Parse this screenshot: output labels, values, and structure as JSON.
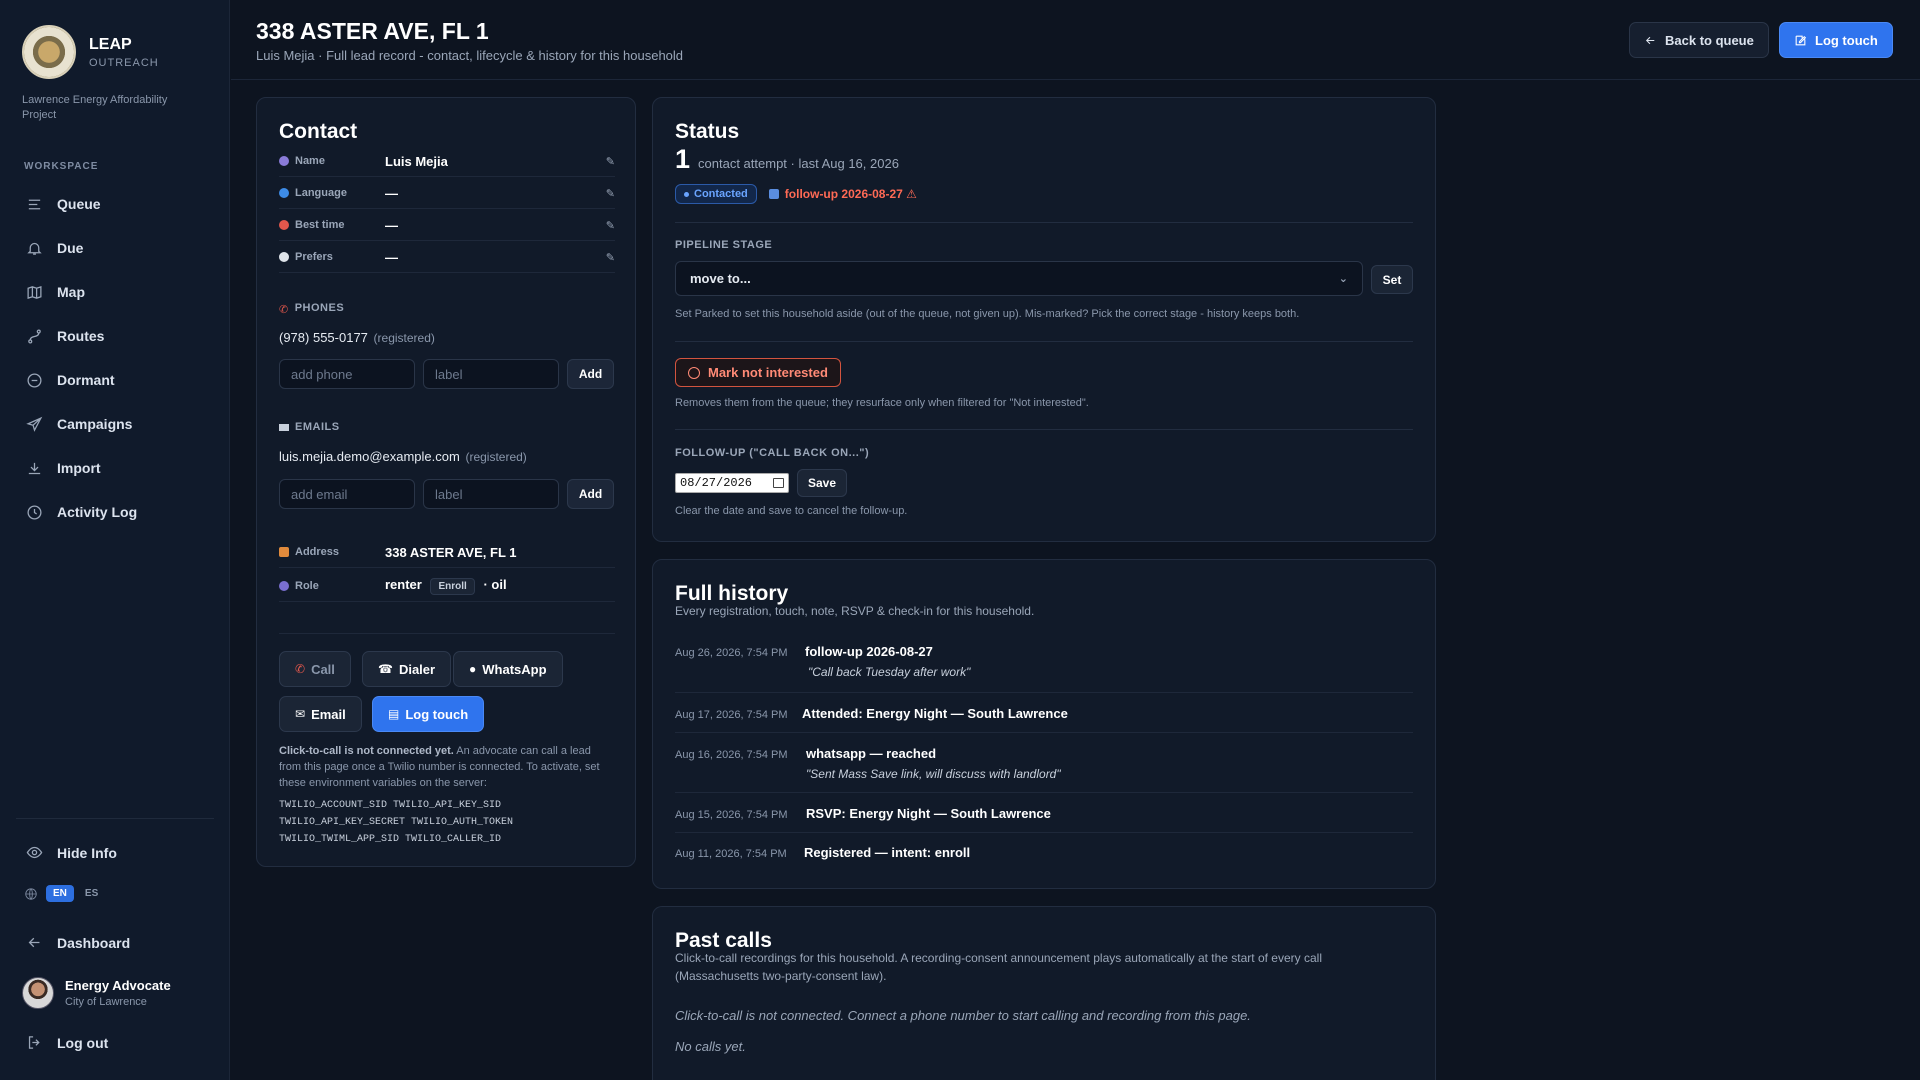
{
  "brand": {
    "name": "LEAP",
    "sub": "OUTREACH",
    "org": "Lawrence Energy Affordability Project"
  },
  "sidebar": {
    "workspace_label": "WORKSPACE",
    "items": [
      {
        "label": "Queue",
        "icon": "list-icon"
      },
      {
        "label": "Due",
        "icon": "bell-icon"
      },
      {
        "label": "Map",
        "icon": "map-icon"
      },
      {
        "label": "Routes",
        "icon": "route-icon"
      },
      {
        "label": "Dormant",
        "icon": "minus-circle-icon"
      },
      {
        "label": "Campaigns",
        "icon": "send-icon"
      },
      {
        "label": "Import",
        "icon": "download-icon"
      },
      {
        "label": "Activity Log",
        "icon": "clock-icon"
      }
    ],
    "hide_info": "Hide Info",
    "lang": {
      "en": "EN",
      "es": "ES",
      "active": "EN"
    },
    "dashboard": "Dashboard",
    "user": {
      "name": "Energy Advocate",
      "org": "City of Lawrence"
    },
    "logout": "Log out"
  },
  "header": {
    "title": "338 ASTER AVE, FL 1",
    "subtitle": "Luis Mejia · Full lead record - contact, lifecycle & history for this household",
    "back_label": "Back to queue",
    "log_label": "Log touch"
  },
  "contact": {
    "title": "Contact",
    "fields": [
      {
        "label": "Name",
        "value": "Luis Mejia"
      },
      {
        "label": "Language",
        "value": "—"
      },
      {
        "label": "Best time",
        "value": "—"
      },
      {
        "label": "Prefers",
        "value": "—"
      }
    ],
    "phones_label": "PHONES",
    "phone": {
      "number": "(978) 555-0177",
      "tag": "(registered)"
    },
    "add_phone_placeholder": "add phone",
    "label_placeholder": "label",
    "add_label": "Add",
    "emails_label": "EMAILS",
    "email": {
      "address": "luis.mejia.demo@example.com",
      "tag": "(registered)"
    },
    "add_email_placeholder": "add email",
    "address_label": "Address",
    "address_value": "338 ASTER AVE, FL 1",
    "role_label": "Role",
    "role_value": "renter",
    "enroll_label": "Enroll",
    "role_suffix": "· oil",
    "actions": {
      "call": "Call",
      "dialer": "Dialer",
      "whatsapp": "WhatsApp",
      "email": "Email",
      "log": "Log touch"
    },
    "note_bold": "Click-to-call is not connected yet.",
    "note_rest": " An advocate can call a lead from this page once a Twilio number is connected. To activate, set these environment variables on the server:",
    "env_lines": [
      "TWILIO_ACCOUNT_SID TWILIO_API_KEY_SID",
      "TWILIO_API_KEY_SECRET TWILIO_AUTH_TOKEN",
      "TWILIO_TWIML_APP_SID TWILIO_CALLER_ID"
    ]
  },
  "status": {
    "title": "Status",
    "count": "1",
    "count_caption": "contact attempt · last Aug 16, 2026",
    "badge": "Contacted",
    "follow_badge": "follow-up 2026-08-27 ⚠",
    "pipeline_label": "PIPELINE STAGE",
    "select_value": "move to...",
    "set_label": "Set",
    "pipeline_help": "Set Parked to set this household aside (out of the queue, not given up). Mis-marked? Pick the correct stage - history keeps both.",
    "mark_label": "Mark not interested",
    "mark_help": "Removes them from the queue; they resurface only when filtered for \"Not interested\".",
    "followup_label": "FOLLOW-UP (\"CALL BACK ON...\")",
    "date_value": "08/27/2026",
    "save_label": "Save",
    "followup_help": "Clear the date and save to cancel the follow-up."
  },
  "history": {
    "title": "Full history",
    "subtitle": "Every registration, touch, note, RSVP & check-in for this household.",
    "items": [
      {
        "time": "Aug 26, 2026, 7:54 PM",
        "title": "follow-up 2026-08-27",
        "note": "\"Call back Tuesday after work\""
      },
      {
        "time": "Aug 17, 2026, 7:54 PM",
        "title": "Attended: Energy Night — South Lawrence",
        "note": ""
      },
      {
        "time": "Aug 16, 2026, 7:54 PM",
        "title": "whatsapp — reached",
        "note": "\"Sent Mass Save link, will discuss with landlord\""
      },
      {
        "time": "Aug 15, 2026, 7:54 PM",
        "title": "RSVP: Energy Night — South Lawrence",
        "note": ""
      },
      {
        "time": "Aug 11, 2026, 7:54 PM",
        "title": "Registered — intent: enroll",
        "note": ""
      }
    ]
  },
  "calls": {
    "title": "Past calls",
    "subtitle": "Click-to-call recordings for this household. A recording-consent announcement plays automatically at the start of every call (Massachusetts two-party-consent law).",
    "not_connected": "Click-to-call is not connected. Connect a phone number to start calling and recording from this page.",
    "empty": "No calls yet."
  }
}
